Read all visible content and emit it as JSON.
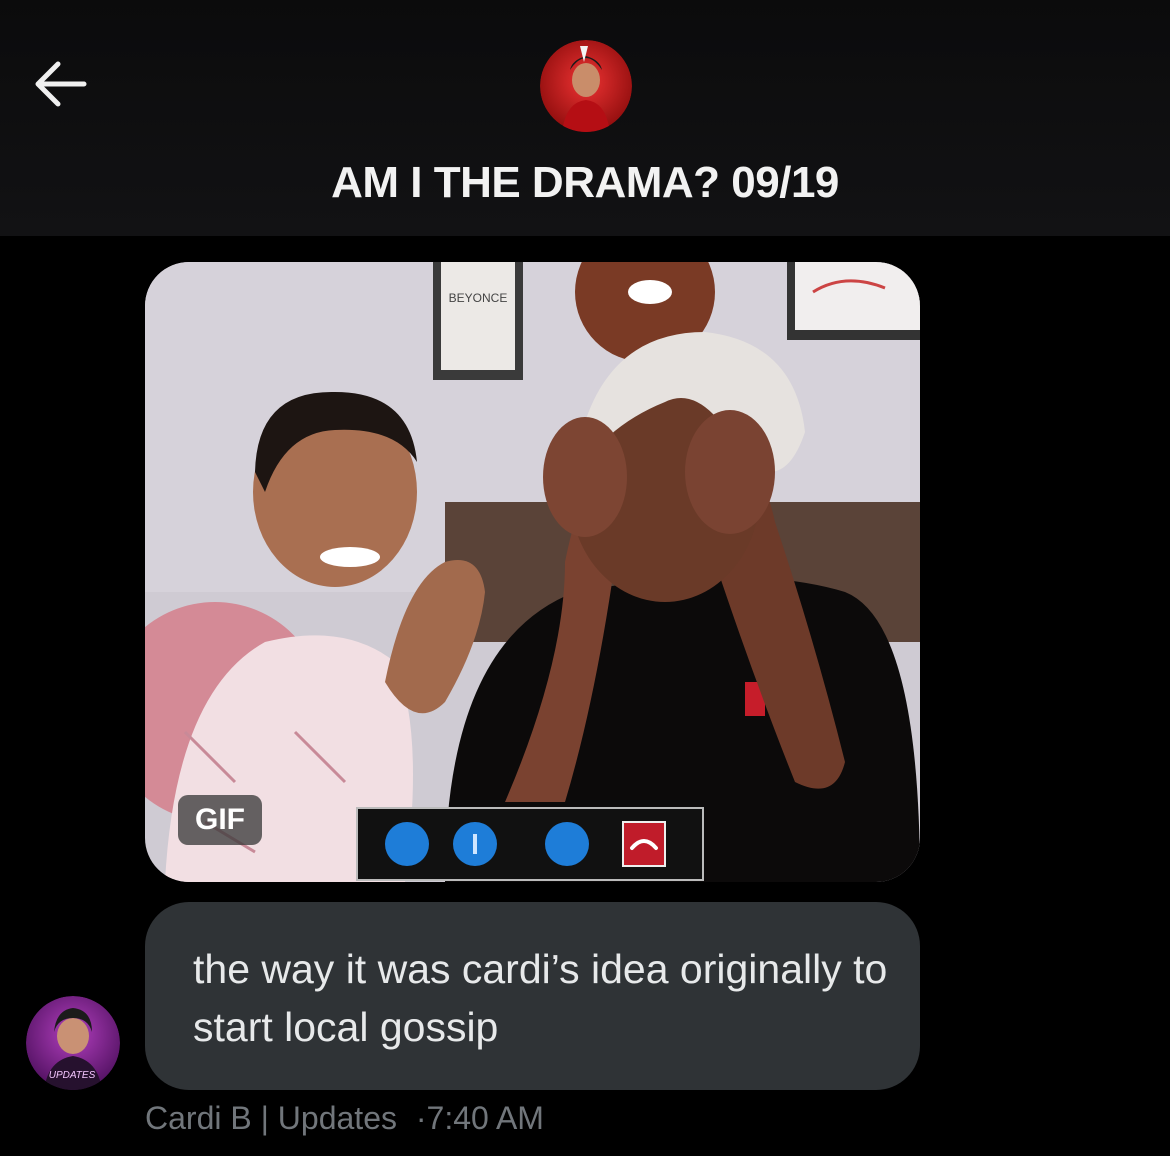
{
  "header": {
    "title": "AM I THE DRAMA? 09/19",
    "back_icon": "arrow-left-icon",
    "avatar": "group-avatar"
  },
  "message": {
    "media": {
      "type": "gif",
      "badge": "GIF",
      "call_controls": [
        "video-icon",
        "info-icon",
        "more-icon",
        "end-call-icon"
      ],
      "poster_text": "BEYONCE"
    },
    "text": "the way it was cardi’s idea originally to start local gossip",
    "sender": "Cardi B | Updates",
    "separator": "·",
    "time": "7:40 AM",
    "sender_avatar_text": "UPDATES"
  },
  "colors": {
    "background": "#000000",
    "bubble": "#2f3336",
    "meta": "#71767b",
    "text": "#e7e9ea"
  }
}
